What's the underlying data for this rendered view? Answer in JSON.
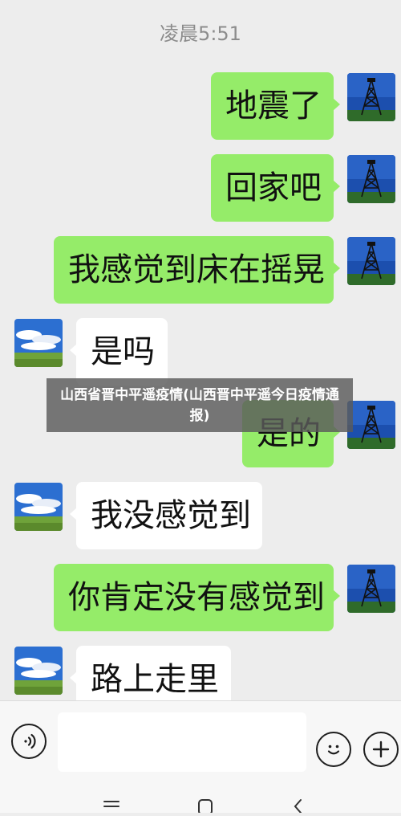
{
  "timestamp": "凌晨5:51",
  "messages": [
    {
      "sender": "me",
      "text": "地震了"
    },
    {
      "sender": "me",
      "text": "回家吧"
    },
    {
      "sender": "me",
      "text": "我感觉到床在摇晃"
    },
    {
      "sender": "other",
      "text": "是吗"
    },
    {
      "sender": "me",
      "text": "是的"
    },
    {
      "sender": "other",
      "text": "我没感觉到"
    },
    {
      "sender": "me",
      "text": "你肯定没有感觉到"
    },
    {
      "sender": "other",
      "text": "路上走里"
    }
  ],
  "overlay_caption": "山西省晋中平遥疫情(山西晋中平遥今日疫情通报)",
  "input_bar": {
    "voice_icon": "voice-icon",
    "emoji_icon": "emoji-icon",
    "add_icon": "plus-icon",
    "input_value": ""
  },
  "nav": {
    "icons": [
      "menu-icon",
      "home-icon",
      "back-icon"
    ]
  },
  "colors": {
    "my_bubble": "#95ec69",
    "their_bubble": "#ffffff",
    "background": "#ededed"
  }
}
